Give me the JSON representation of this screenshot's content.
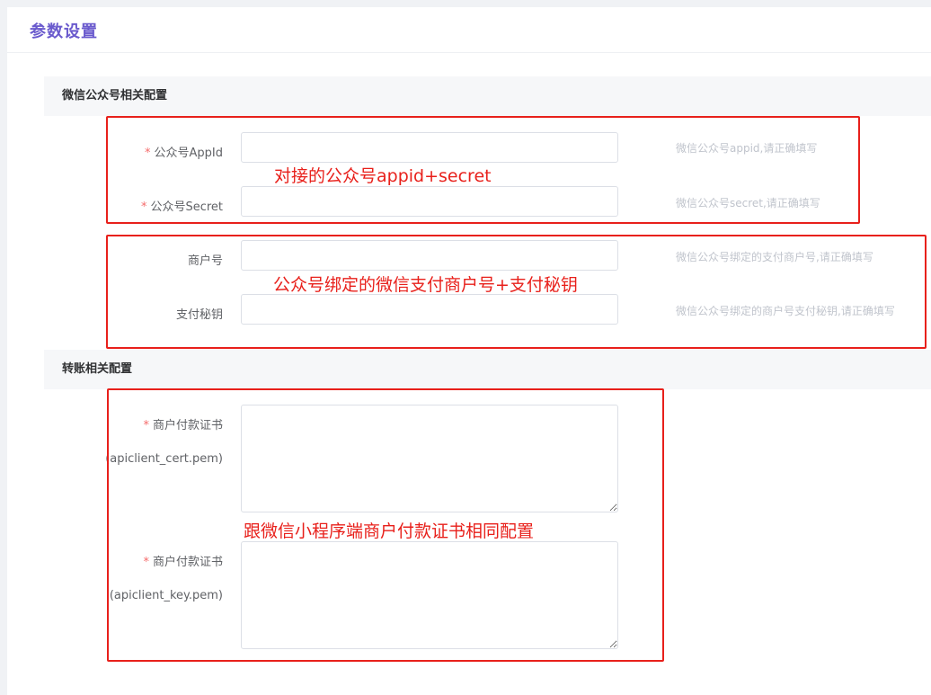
{
  "page": {
    "title": "参数设置"
  },
  "sections": {
    "wechat": {
      "title": "微信公众号相关配置"
    },
    "transfer": {
      "title": "转账相关配置"
    }
  },
  "fields": {
    "appid": {
      "label": "公众号AppId",
      "required": true,
      "value": "",
      "hint": "微信公众号appid,请正确填写"
    },
    "secret": {
      "label": "公众号Secret",
      "required": true,
      "value": "",
      "hint": "微信公众号secret,请正确填写"
    },
    "merchant_no": {
      "label": "商户号",
      "required": false,
      "value": "",
      "hint": "微信公众号绑定的支付商户号,请正确填写"
    },
    "pay_key": {
      "label": "支付秘钥",
      "required": false,
      "value": "",
      "hint": "微信公众号绑定的商户号支付秘钥,请正确填写"
    },
    "cert_pem": {
      "label": "商户付款证书",
      "sublabel": "(apiclient_cert.pem)",
      "required": true,
      "value": ""
    },
    "key_pem": {
      "label": "商户付款证书",
      "sublabel": "(apiclient_key.pem)",
      "required": true,
      "value": ""
    }
  },
  "annotations": {
    "appid_secret": "对接的公众号appid+secret",
    "merchant": "公众号绑定的微信支付商户号+支付秘钥",
    "cert": "跟微信小程序端商户付款证书相同配置"
  },
  "colors": {
    "accent": "#6a5acd",
    "required": "#f56c6c",
    "annotation": "#e8201b"
  }
}
